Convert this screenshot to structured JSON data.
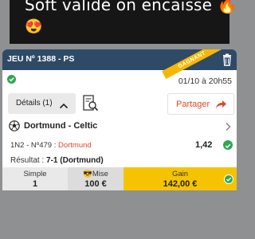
{
  "story": {
    "caption": "Soft validé on encaisse 🔥",
    "caption_emoji": "😍"
  },
  "bet": {
    "game_title": "JEU Nº 1388 - PS",
    "ribbon": "GAGNANT",
    "datetime": "01/10 à 20h55",
    "details_label": "Détails (1)",
    "share_label": "Partager",
    "match": "Dortmund - Celtic",
    "pick_prefix": "1N2 - Nº479 : ",
    "pick_team": "Dortmund",
    "odds": "1,42",
    "result_label": "Résultat : ",
    "result_value": "7-1 (Dortmund)",
    "type_label": "Simple",
    "type_value": "1",
    "stake_label": "Mise",
    "stake_emoji": "😎",
    "stake_value": "100 €",
    "gain_label": "Gain",
    "gain_value": "142,00 €"
  },
  "colors": {
    "header": "#2f4a67",
    "ribbon": "#f5b800",
    "gain_bg": "#f6c300",
    "accent": "#d94b2b",
    "success": "#2fa84f"
  },
  "icons": [
    "trash-icon",
    "check-icon",
    "chevron-up-icon",
    "receipt-search-icon",
    "share-arrow-icon",
    "soccer-ball-icon",
    "chevron-right-icon"
  ]
}
